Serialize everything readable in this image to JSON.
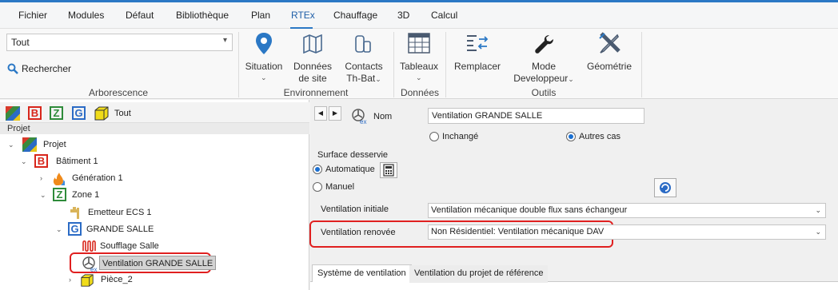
{
  "menu": [
    "Fichier",
    "Modules",
    "Défaut",
    "Bibliothèque",
    "Plan",
    "RTEx",
    "Chauffage",
    "3D",
    "Calcul"
  ],
  "menu_active": "RTEx",
  "ribbon": {
    "combo_value": "Tout",
    "search_label": "Rechercher",
    "groups": {
      "arborescence": "Arborescence",
      "environnement": "Environnement",
      "donnees": "Données",
      "outils": "Outils"
    },
    "buttons": {
      "situation": "Situation",
      "donnees_site_1": "Données",
      "donnees_site_2": "de site",
      "contacts_1": "Contacts",
      "contacts_2": "Th-Bat",
      "tableaux": "Tableaux",
      "remplacer": "Remplacer",
      "mode_1": "Mode",
      "mode_2": "Developpeur",
      "geometrie": "Géométrie"
    }
  },
  "left": {
    "toolbar_all": "Tout",
    "project_header": "Projet",
    "tree": {
      "projet": "Projet",
      "batiment": "Bâtiment 1",
      "generation": "Génération 1",
      "zone": "Zone 1",
      "emetteur": "Emetteur ECS 1",
      "grande_salle": "GRANDE SALLE",
      "soufflage": "Soufflage Salle",
      "ventilation": "Ventilation GRANDE SALLE",
      "piece": "Pièce_2"
    }
  },
  "right": {
    "nom_label": "Nom",
    "nom_value": "Ventilation GRANDE SALLE",
    "radio_inchange": "Inchangé",
    "radio_autres": "Autres cas",
    "surface_label": "Surface desservie",
    "radio_auto": "Automatique",
    "radio_manuel": "Manuel",
    "vent_initiale_label": "Ventilation initiale",
    "vent_initiale_value": "Ventilation mécanique double flux sans échangeur",
    "vent_renovee_label": "Ventilation renovée",
    "vent_renovee_value": "Non Résidentiel: Ventilation mécanique DAV",
    "tab1": "Système de ventilation",
    "tab2": "Ventilation du projet de référence"
  },
  "colors": {
    "accent": "#2b78c5",
    "highlight": "#e02020"
  }
}
